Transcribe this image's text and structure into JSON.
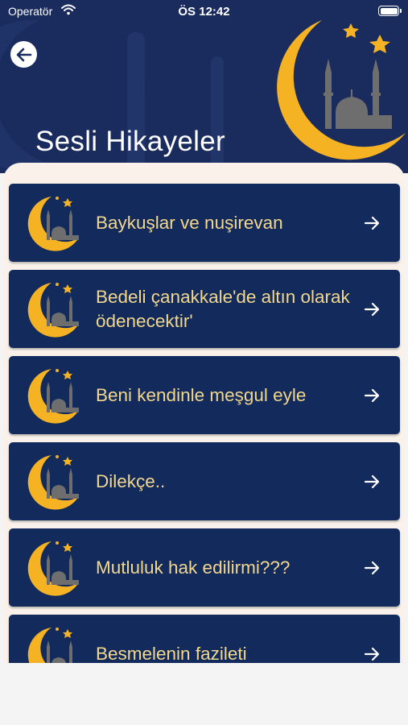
{
  "status_bar": {
    "carrier": "Operatör",
    "time": "ÖS 12:42"
  },
  "header": {
    "title": "Sesli Hikayeler"
  },
  "colors": {
    "header_bg": "#1a2b5e",
    "card_bg": "#122a5c",
    "card_text": "#f2d78c",
    "moon": "#f5b223",
    "mosque": "#6e6e6e",
    "panel_bg": "#f9f1ea"
  },
  "stories": [
    {
      "title": "Baykuşlar ve nuşirevan"
    },
    {
      "title": "Bedeli çanakkale'de altın olarak ödenecektir'"
    },
    {
      "title": "Beni kendinle meşgul eyle"
    },
    {
      "title": "Dilekçe.."
    },
    {
      "title": "Mutluluk hak edilirmi???"
    },
    {
      "title": "Besmelenin fazileti"
    }
  ]
}
